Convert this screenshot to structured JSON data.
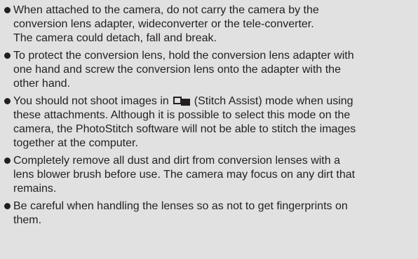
{
  "notes": [
    {
      "lines": [
        "When attached to the camera, do not carry the camera by the",
        "conversion lens adapter, wideconverter or the tele-converter.",
        "The camera could detach, fall and break."
      ]
    },
    {
      "lines": [
        "To protect the conversion lens, hold the conversion lens adapter with",
        "one hand and screw the conversion lens onto the adapter with the",
        "other hand."
      ]
    },
    {
      "first_line_before_icon": "You should not shoot images in",
      "icon": "stitch-assist-icon",
      "first_line_after_icon": "(Stitch Assist) mode when using",
      "lines": [
        "these attachments. Although it is possible to select this mode on the",
        "camera, the PhotoStitch software will not be able to stitch the images",
        "together at the computer."
      ]
    },
    {
      "lines": [
        "Completely remove all dust and dirt from conversion lenses with a",
        "lens blower brush before use. The camera may focus on any dirt that",
        "remains."
      ]
    },
    {
      "lines": [
        "Be careful when handling the lenses so as not to get fingerprints on",
        "them."
      ]
    }
  ],
  "colors": {
    "background": "#e1e1e2",
    "text": "#231f20"
  }
}
